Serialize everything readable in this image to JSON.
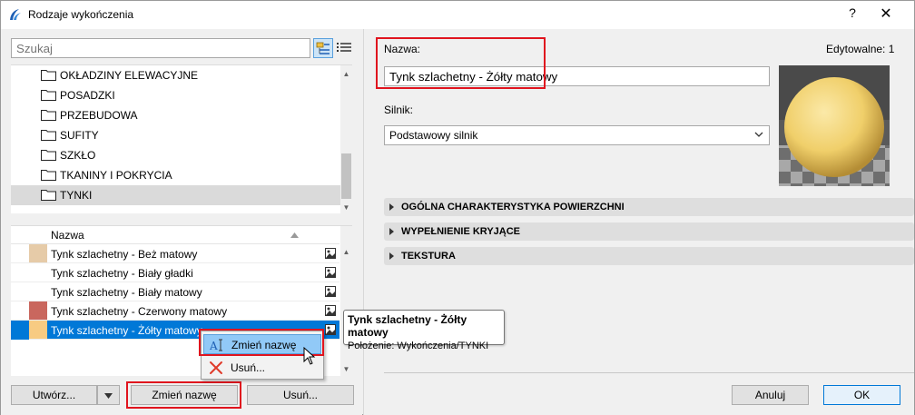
{
  "window": {
    "title": "Rodzaje wykończenia",
    "help": "?",
    "close": "✕"
  },
  "search": {
    "placeholder": "Szukaj"
  },
  "folders": [
    {
      "label": "OKŁADZINY ELEWACYJNE"
    },
    {
      "label": "POSADZKI"
    },
    {
      "label": "PRZEBUDOWA"
    },
    {
      "label": "SUFITY"
    },
    {
      "label": "SZKŁO"
    },
    {
      "label": "TKANINY I POKRYCIA"
    },
    {
      "label": "TYNKI",
      "selected": true
    }
  ],
  "list": {
    "header": {
      "name": "Nazwa"
    },
    "rows": [
      {
        "label": "Tynk szlachetny - Beż matowy",
        "swatch": "#e6cba8"
      },
      {
        "label": "Tynk szlachetny - Biały gładki",
        "swatch": "#ffffff"
      },
      {
        "label": "Tynk szlachetny - Biały matowy",
        "swatch": "#ffffff"
      },
      {
        "label": "Tynk szlachetny - Czerwony matowy",
        "swatch": "#c9675e"
      },
      {
        "label": "Tynk szlachetny - Żółty matowy",
        "swatch": "#f7cb82",
        "selected": true
      }
    ]
  },
  "buttons": {
    "create": "Utwórz...",
    "rename": "Zmień nazwę",
    "delete": "Usuń...",
    "cancel": "Anuluj",
    "ok": "OK"
  },
  "context_menu": {
    "rename": "Zmień nazwę",
    "delete": "Usuń..."
  },
  "tooltip": {
    "title": "Tynk szlachetny - Żółty matowy",
    "location": "Położenie: Wykończenia/TYNKI"
  },
  "details": {
    "name_label": "Nazwa:",
    "name_value": "Tynk szlachetny - Żółty matowy",
    "editable": "Edytowalne: 1",
    "engine_label": "Silnik:",
    "engine_value": "Podstawowy silnik",
    "sections": [
      "OGÓLNA CHARAKTERYSTYKA POWIERZCHNI",
      "WYPEŁNIENIE KRYJĄCE",
      "TEKSTURA"
    ]
  },
  "colors": {
    "selection": "#0078d7",
    "highlight": "#e0141e",
    "menu_hover": "#91c9f7"
  }
}
